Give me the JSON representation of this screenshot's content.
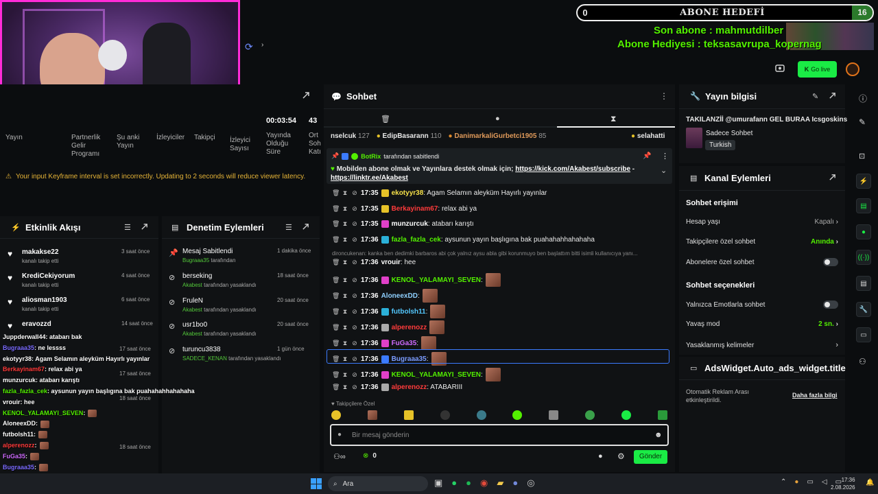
{
  "overlay": {
    "goal_left": "0",
    "goal_title": "ABONE HEDEFİ",
    "goal_right": "16",
    "sub_line1": "Son abone : mahmutdilber",
    "sub_line2": "Abone Hediyesi : teksasavrupa_kopernag"
  },
  "topbar": {
    "go_live": "Go live"
  },
  "stats": [
    {
      "label": "Yayın",
      "value": ""
    },
    {
      "label": "Partnerlik Gelir Programı",
      "value": ""
    },
    {
      "label": "Şu anki Yayın",
      "value": ""
    },
    {
      "label": "İzleyiciler",
      "value": ""
    },
    {
      "label": "Takipçi",
      "value": ""
    },
    {
      "label": "İzleyici Sayısı",
      "value": ""
    },
    {
      "label": "Yayında Olduğu Süre",
      "value": "00:03:54"
    },
    {
      "label": "Ort Sohbet Katılım",
      "value": "43"
    }
  ],
  "warning": "Your input Keyframe interval is set incorrectly. Updating to 2 seconds will reduce viewer latency.",
  "activity": {
    "title": "Etkinlik Akışı",
    "items": [
      {
        "name": "makakse22",
        "sub": "kanalı takip etti",
        "time": "3 saat önce"
      },
      {
        "name": "KrediCekiyorum",
        "sub": "kanalı takip etti",
        "time": "4 saat önce"
      },
      {
        "name": "aliosman1903",
        "sub": "kanalı takip etti",
        "time": "6 saat önce"
      },
      {
        "name": "eravozzd",
        "sub": "",
        "time": "14 saat önce"
      }
    ],
    "more_times": [
      "17 saat önce",
      "17 saat önce",
      "18 saat önce",
      "18 saat önce"
    ]
  },
  "moderation": {
    "title": "Denetim Eylemleri",
    "items": [
      {
        "name": "Mesaj Sabitlendi",
        "who": "Bugraaa35",
        "sub": "tarafından",
        "time": "1 dakika önce",
        "icon": "pin-icon"
      },
      {
        "name": "berseking",
        "who": "Akabest",
        "sub": "tarafından yasaklandı",
        "time": "18 saat önce",
        "icon": "ban-icon"
      },
      {
        "name": "FruleN",
        "who": "Akabest",
        "sub": "tarafından yasaklandı",
        "time": "20 saat önce",
        "icon": "ban-icon"
      },
      {
        "name": "usr1bo0",
        "who": "Akabest",
        "sub": "tarafından yasaklandı",
        "time": "20 saat önce",
        "icon": "ban-icon"
      },
      {
        "name": "turuncu3838",
        "who": "SADECE_KENAN",
        "sub": "tarafından yasaklandı",
        "time": "1 gün önce",
        "icon": "ban-icon"
      }
    ]
  },
  "overlay_chat": [
    {
      "name": "Juppderwall44",
      "color": "#ffffff",
      "text": ": atabarı bak"
    },
    {
      "name": "Bugraaa35",
      "color": "#7b6cff",
      "text": ": ne lessss"
    },
    {
      "name": "ekotyyr38",
      "color": "#ffffff",
      "text": ": Agam Selamın aleyküm Hayırlı yayınlar"
    },
    {
      "name": "Berkayinam67",
      "color": "#ff3b3b",
      "text": ": relax abi ya"
    },
    {
      "name": "munzurcuk",
      "color": "#ffffff",
      "text": ": atabarı karıştı"
    },
    {
      "name": "fazla_fazla_cek",
      "color": "#53f000",
      "text": ": aysunun yayın başlıgına bak puahahahhahahaha"
    },
    {
      "name": "vrouir",
      "color": "#ffffff",
      "text": ": hee"
    },
    {
      "name": "KENOL_YALAMAYI_SEVEN",
      "color": "#53f000",
      "text": ":"
    },
    {
      "name": "AloneexDD",
      "color": "#ffffff",
      "text": ":"
    },
    {
      "name": "futbolsh11",
      "color": "#ffffff",
      "text": ":"
    },
    {
      "name": "alperenozz",
      "color": "#ff3b3b",
      "text": ":"
    },
    {
      "name": "FuGa35",
      "color": "#cf6cff",
      "text": ":"
    },
    {
      "name": "Bugraaa35",
      "color": "#7b6cff",
      "text": ":"
    },
    {
      "name": "KENOL_YALAMAYI_SEVEN",
      "color": "#53f000",
      "text": ":"
    },
    {
      "name": "alperenozz",
      "color": "#ff3b3b",
      "text": ": ATABARIII"
    }
  ],
  "chat": {
    "title": "Sohbet",
    "leaders": [
      {
        "name": "nselcuk",
        "count": "127"
      },
      {
        "name": "EdipBasarann",
        "count": "110"
      },
      {
        "name": "DanimarkaliGurbetci1905",
        "count": "85"
      },
      {
        "name": "selahatti",
        "count": ""
      }
    ],
    "pinned_by": "BotRix",
    "pinned_by_suffix": "tarafından sabitlendi",
    "pinned_text": "Mobilden abone olmak ve Yayınlara destek olmak için;",
    "pinned_link1": "https://kick.com/Akabest/subscribe",
    "pinned_link2": "https://linktr.ee/Akabest",
    "messages": [
      {
        "time": "17:35",
        "name": "ekotyyr38",
        "color": "#f5e049",
        "badge": "#e6c228",
        "text": ": Agam Selamın aleyküm Hayırlı yayınlar",
        "emotes": 0
      },
      {
        "time": "17:35",
        "name": "Berkayinam67",
        "color": "#ff3b3b",
        "badge": "#e6c228",
        "text": ": relax abi ya",
        "emotes": 0
      },
      {
        "time": "17:35",
        "name": "munzurcuk",
        "color": "#ffffff",
        "badge": "#e040c8",
        "text": ": atabarı karıştı",
        "emotes": 0
      },
      {
        "time": "17:36",
        "name": "fazla_fazla_cek",
        "color": "#53f000",
        "badge": "#2bb0d8",
        "text": ": aysunun yayın başlıgına bak puahahahhahahaha",
        "emotes": 0
      }
    ],
    "reply_hint": "dironcukenan: kanka ben dedimki barbaros abi çok yalnız aysu abla gibi korunmuyo ben başlattım bitti isimli kullanıcıya yanı...",
    "messages2": [
      {
        "time": "17:36",
        "name": "vrouir",
        "color": "#ffffff",
        "badge": "",
        "text": ": hee",
        "emotes": 0
      },
      {
        "time": "17:36",
        "name": "KENOL_YALAMAYI_SEVEN",
        "color": "#53f000",
        "badge": "#e040c8",
        "text": ":",
        "emotes": 1
      },
      {
        "time": "17:36",
        "name": "AloneexDD",
        "color": "#8fd0ff",
        "badge": "",
        "text": ":",
        "emotes": 1
      },
      {
        "time": "17:36",
        "name": "futbolsh11",
        "color": "#53c8ff",
        "badge": "#2bb0d8",
        "text": ":",
        "emotes": 1
      },
      {
        "time": "17:36",
        "name": "alperenozz",
        "color": "#ff3b3b",
        "badge": "#aaaaaa",
        "text": "",
        "emotes": 1
      },
      {
        "time": "17:36",
        "name": "FuGa35",
        "color": "#cf6cff",
        "badge": "#e040c8",
        "text": ":",
        "emotes": 1
      },
      {
        "time": "17:36",
        "name": "Bugraaa35",
        "color": "#7b9cff",
        "badge": "#3b7bff",
        "text": ":",
        "emotes": 1
      },
      {
        "time": "17:36",
        "name": "KENOL_YALAMAYI_SEVEN",
        "color": "#53f000",
        "badge": "#e040c8",
        "text": ":",
        "emotes": 1
      },
      {
        "time": "17:36",
        "name": "alperenozz",
        "color": "#ff3b3b",
        "badge": "#aaaaaa",
        "text": ": ATABARIII",
        "emotes": 0
      }
    ],
    "emote_label": "Takipçilere Özel",
    "input_placeholder": "Bir mesaj gönderin",
    "points": "0",
    "send": "Gönder"
  },
  "stream_info": {
    "title": "Yayın bilgisi",
    "stream_title": "TAKILANZİİ @umurafann GEL BURAA Icsgoskins",
    "category": "Sadece Sohbet",
    "language": "Turkish"
  },
  "channel_actions": {
    "title": "Kanal Eylemleri",
    "chat_access": "Sohbet erişimi",
    "account_age": "Hesap yaşı",
    "account_age_val": "Kapalı",
    "followers_only": "Takipçilere özel sohbet",
    "followers_only_val": "Anında",
    "subs_only": "Abonelere özel sohbet",
    "chat_options": "Sohbet seçenekleri",
    "emote_only": "Yalnızca Emotlarla sohbet",
    "slow_mode": "Yavaş mod",
    "slow_mode_val": "2 sn.",
    "banned_words": "Yasaklanmış kelimeler"
  },
  "ads": {
    "title": "AdsWidget.Auto_ads_widget.title",
    "text": "Otomatik Reklam Arası etkinleştirildi.",
    "link": "Daha fazla bilgi"
  },
  "taskbar": {
    "search": "Ara",
    "time": "17:36",
    "date": "2.08.2026"
  }
}
